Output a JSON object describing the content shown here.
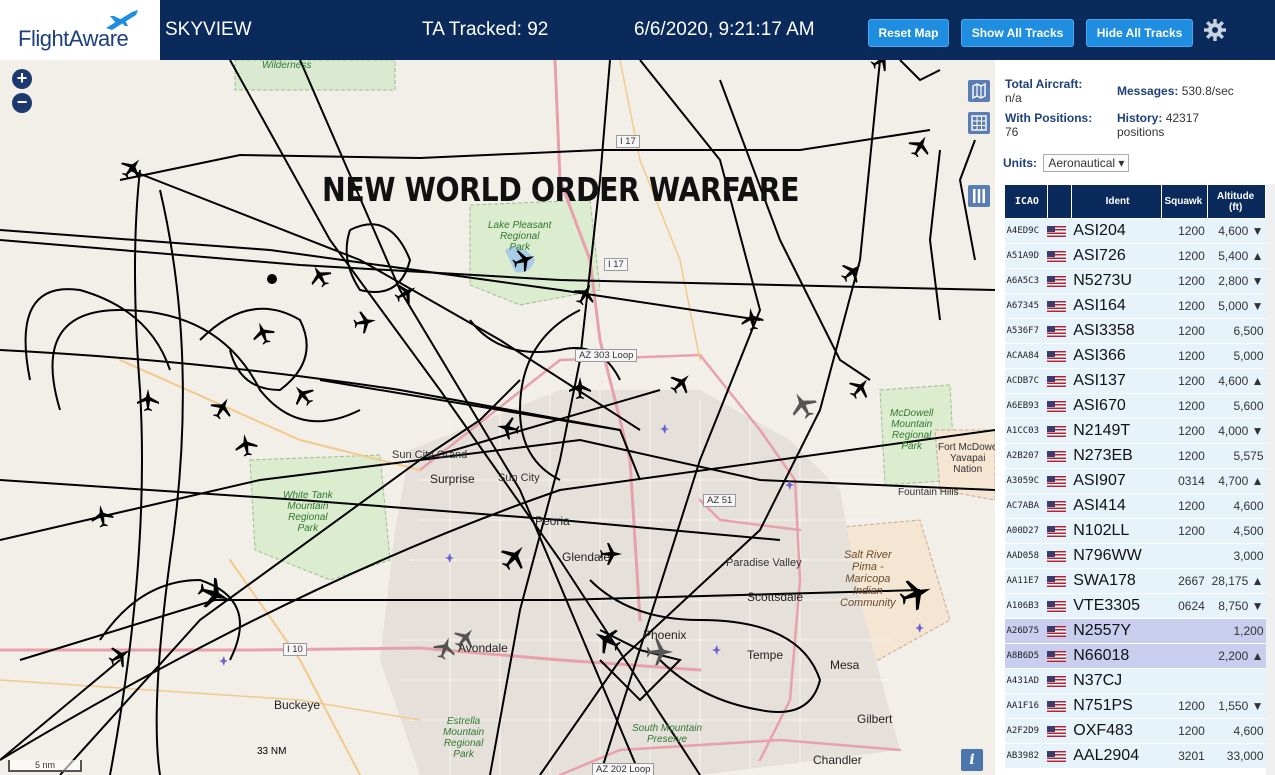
{
  "header": {
    "logo_text": "FlightAware",
    "site_name": "SKYVIEW",
    "tracked_label": "TA Tracked: 92",
    "datetime": "6/6/2020, 9:21:17 AM",
    "reset_map": "Reset Map",
    "show_all_tracks": "Show All Tracks",
    "hide_all_tracks": "Hide All Tracks"
  },
  "map": {
    "overlay_text": "NEW WORLD ORDER WARFARE",
    "scale_left": "5 nm",
    "scale_right": "33 NM",
    "zoom_in": "+",
    "zoom_out": "−",
    "info": "i",
    "labels": {
      "wilderness": "Wilderness",
      "lake_pleasant": "Lake Pleasant\nRegional\nPark",
      "sun_city_grand": "Sun City Grand",
      "surprise": "Surprise",
      "sun_city": "Sun City",
      "white_tank": "White Tank\nMountain\nRegional\nPark",
      "peoria": "Peoria",
      "glendale": "Glendale",
      "paradise_valley": "Paradise Valley",
      "scottsdale": "Scottsdale",
      "phoenix": "Phoenix",
      "avondale": "Avondale",
      "buckeye": "Buckeye",
      "tempe": "Tempe",
      "mesa": "Mesa",
      "gilbert": "Gilbert",
      "chandler": "Chandler",
      "estrella": "Estrella\nMountain\nRegional\nPark",
      "south_mountain": "South Mountain\nPreserve",
      "mcdowell": "McDowell\nMountain\nRegional\nPark",
      "fort_mcdowell": "Fort McDowe\nYavapai\nNation",
      "fountain_hills": "Fountain Hills",
      "salt_river": "Salt River\nPima -\nMaricopa\nIndian\nCommunity",
      "i17_top": "I 17",
      "i17_mid": "I 17",
      "az303": "AZ 303 Loop",
      "az51": "AZ 51",
      "i10": "I 10",
      "az202": "AZ 202 Loop"
    }
  },
  "stats": {
    "total_aircraft_label": "Total Aircraft:",
    "total_aircraft_value": "n/a",
    "with_positions_label": "With Positions:",
    "with_positions_value": "76",
    "messages_label": "Messages:",
    "messages_value": "530.8/sec",
    "history_label": "History:",
    "history_value": "42317",
    "history_unit": "positions",
    "units_label": "Units:",
    "units_value": "Aeronautical ▾"
  },
  "table": {
    "headers": [
      "ICAO",
      "",
      "Ident",
      "Squawk",
      "Altitude\n(ft)"
    ],
    "rows": [
      {
        "icao": "A4ED9C",
        "ident": "ASI204",
        "squawk": "1200",
        "alt": "4,600 ▼",
        "selected": false
      },
      {
        "icao": "A51A9D",
        "ident": "ASI726",
        "squawk": "1200",
        "alt": "5,400 ▲",
        "selected": false
      },
      {
        "icao": "A6A5C3",
        "ident": "N5273U",
        "squawk": "1200",
        "alt": "2,800 ▼",
        "selected": false
      },
      {
        "icao": "A67345",
        "ident": "ASI164",
        "squawk": "1200",
        "alt": "5,000 ▼",
        "selected": false
      },
      {
        "icao": "A536F7",
        "ident": "ASI3358",
        "squawk": "1200",
        "alt": "6,500",
        "selected": false
      },
      {
        "icao": "ACAA84",
        "ident": "ASI366",
        "squawk": "1200",
        "alt": "5,000",
        "selected": false
      },
      {
        "icao": "ACDB7C",
        "ident": "ASI137",
        "squawk": "1200",
        "alt": "4,600 ▲",
        "selected": false
      },
      {
        "icao": "A6EB93",
        "ident": "ASI670",
        "squawk": "1200",
        "alt": "5,600",
        "selected": false
      },
      {
        "icao": "A1CC03",
        "ident": "N2149T",
        "squawk": "1200",
        "alt": "4,000 ▼",
        "selected": false
      },
      {
        "icao": "A2B207",
        "ident": "N273EB",
        "squawk": "1200",
        "alt": "5,575",
        "selected": false
      },
      {
        "icao": "A3059C",
        "ident": "ASI907",
        "squawk": "0314",
        "alt": "4,700 ▲",
        "selected": false
      },
      {
        "icao": "AC7ABA",
        "ident": "ASI414",
        "squawk": "1200",
        "alt": "4,600",
        "selected": false
      },
      {
        "icao": "A00D27",
        "ident": "N102LL",
        "squawk": "1200",
        "alt": "4,500",
        "selected": false
      },
      {
        "icao": "AAD058",
        "ident": "N796WW",
        "squawk": "",
        "alt": "3,000",
        "selected": false
      },
      {
        "icao": "AA11E7",
        "ident": "SWA178",
        "squawk": "2667",
        "alt": "28,175 ▲",
        "selected": false
      },
      {
        "icao": "A106B3",
        "ident": "VTE3305",
        "squawk": "0624",
        "alt": "8,750 ▼",
        "selected": false
      },
      {
        "icao": "A26D75",
        "ident": "N2557Y",
        "squawk": "",
        "alt": "1,200",
        "selected": true
      },
      {
        "icao": "A8B6D5",
        "ident": "N66018",
        "squawk": "",
        "alt": "2,200 ▲",
        "selected": true
      },
      {
        "icao": "A431AD",
        "ident": "N37CJ",
        "squawk": "",
        "alt": "",
        "selected": false
      },
      {
        "icao": "AA1F16",
        "ident": "N751PS",
        "squawk": "1200",
        "alt": "1,550 ▼",
        "selected": false
      },
      {
        "icao": "A2F2D9",
        "ident": "OXF483",
        "squawk": "1200",
        "alt": "4,600",
        "selected": false
      },
      {
        "icao": "AB3982",
        "ident": "AAL2904",
        "squawk": "3201",
        "alt": "33,000",
        "selected": false
      }
    ]
  },
  "colors": {
    "header_bg": "#0a2a5c",
    "button_bg": "#1f8ee0",
    "row_bg": "#e6f3fb",
    "row_selected_bg": "#c9ceee",
    "track_color": "#000000"
  }
}
